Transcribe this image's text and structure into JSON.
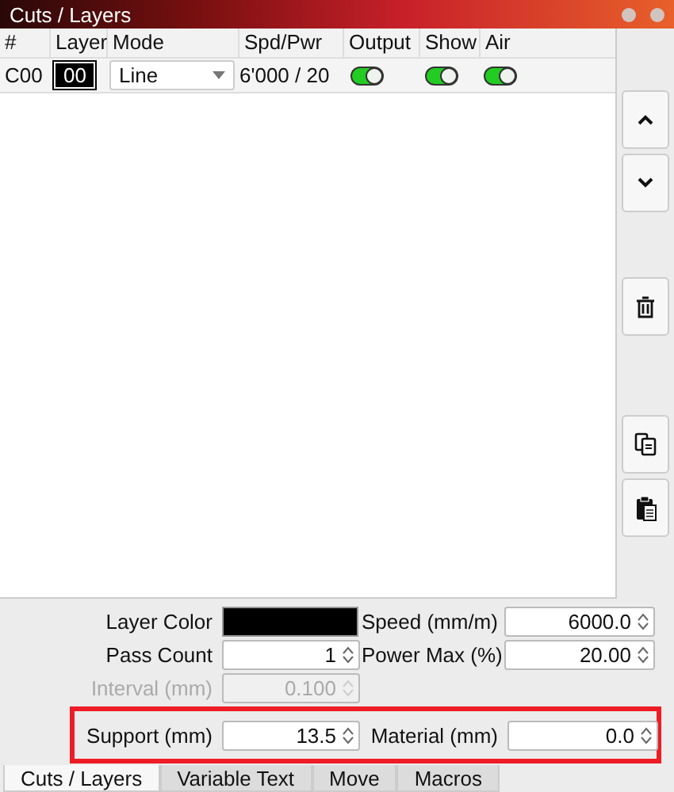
{
  "window": {
    "title": "Cuts / Layers"
  },
  "table": {
    "columns": [
      "#",
      "Layer",
      "Mode",
      "Spd/Pwr",
      "Output",
      "Show",
      "Air"
    ],
    "rows": [
      {
        "cut": "C00",
        "layer": "00",
        "mode": "Line",
        "spd_pwr": "6'000 / 20",
        "output": true,
        "show": true,
        "air": true
      }
    ]
  },
  "side_buttons": [
    {
      "kind": "up"
    },
    {
      "kind": "down"
    },
    {
      "kind": "gap"
    },
    {
      "kind": "delete"
    },
    {
      "kind": "gap"
    },
    {
      "kind": "copy"
    },
    {
      "kind": "paste"
    }
  ],
  "settings": [
    {
      "highlighted": false,
      "cells": [
        {
          "kind": "color",
          "label": "Layer Color",
          "color": "#000000"
        },
        {
          "kind": "spin",
          "label": "Speed (mm/m)",
          "value": "6000.0",
          "disabled": false
        }
      ]
    },
    {
      "highlighted": false,
      "cells": [
        {
          "kind": "spin",
          "label": "Pass Count",
          "value": "1",
          "disabled": false
        },
        {
          "kind": "spin",
          "label": "Power Max (%)",
          "value": "20.00",
          "disabled": false
        }
      ]
    },
    {
      "highlighted": false,
      "cells": [
        {
          "kind": "spin",
          "label": "Interval (mm)",
          "value": "0.100",
          "disabled": true
        }
      ]
    },
    {
      "highlighted": true,
      "cells": [
        {
          "kind": "spin",
          "label": "Support (mm)",
          "value": "13.5",
          "disabled": false
        },
        {
          "kind": "spin",
          "label": "Material (mm)",
          "value": "0.0",
          "disabled": false
        }
      ]
    }
  ],
  "tabs": [
    {
      "label": "Cuts / Layers",
      "selected": true
    },
    {
      "label": "Variable Text",
      "selected": false
    },
    {
      "label": "Move",
      "selected": false
    },
    {
      "label": "Macros",
      "selected": false
    }
  ]
}
